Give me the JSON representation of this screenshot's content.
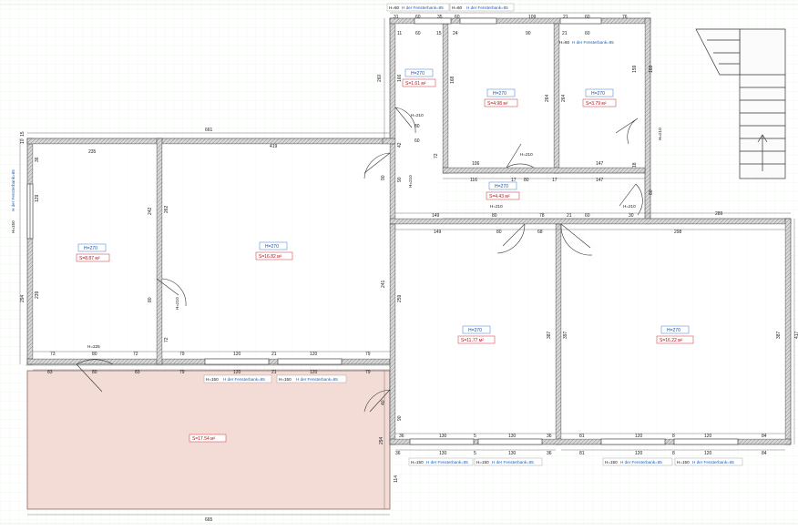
{
  "colors": {
    "grid": "#d7e8d7",
    "wall": "#555555",
    "terrace": "#f3dcd5",
    "room_s": "#b5121b",
    "blue_text": "#1a5fbf"
  },
  "rooms": [
    {
      "id": "r1",
      "h": "H=270",
      "s": "S=8.87 м²"
    },
    {
      "id": "r2",
      "h": "H=270",
      "s": "S=16.82 м²"
    },
    {
      "id": "r3",
      "h": "H=270",
      "s": "S=1.61 м²"
    },
    {
      "id": "r4",
      "h": "H=270",
      "s": "S=4.98 м²"
    },
    {
      "id": "r5",
      "h": "H=270",
      "s": "S=3.79 м²"
    },
    {
      "id": "r6",
      "h": "H=270",
      "s": "S=4.43 м²"
    },
    {
      "id": "r7",
      "h": "H=270",
      "s": "S=11.77 м²"
    },
    {
      "id": "r8",
      "h": "H=270",
      "s": "S=16.22 м²"
    }
  ],
  "terrace": {
    "s": "S=17.54 м²"
  },
  "windows": {
    "top_a": "H=60",
    "top_a_sill": "H der Fensterbank=85",
    "top_b": "H=60",
    "top_b_sill": "H der Fensterbank=85",
    "r5": "H=60",
    "r5_sill": "H der Fensterbank=85",
    "left": "H=150",
    "left_sill": "H der Fensterbank=65",
    "mid_a": "H=150",
    "mid_a_sill": "H der Fensterbank=65",
    "mid_b": "H=150",
    "mid_b_sill": "H der Fensterbank=65",
    "bot_a": "H=150",
    "bot_a_sill": "H der Fensterbank=65",
    "bot_b": "H=150",
    "bot_b_sill": "H der Fensterbank=65",
    "bot_c": "H=150",
    "bot_c_sill": "H der Fensterbank=65",
    "bot_d": "H=150",
    "bot_d_sill": "H der Fensterbank=65"
  },
  "doors": {
    "d1": "H=210",
    "d2": "H=210",
    "d3": "H=210",
    "d4": "H=210",
    "d5": "H=210",
    "d6": "H=210",
    "d7": "H=210",
    "d8": "H=225"
  },
  "dims": {
    "top1": "31",
    "top2": "60",
    "top3": "35",
    "top4": "60",
    "top5": "109",
    "top6": "21",
    "top7": "60",
    "top8": "76",
    "row2a": "11",
    "row2b": "60",
    "row2c": "15",
    "row2d": "24",
    "row2e": "90",
    "row2f": "21",
    "row2g": "60",
    "overall_top": "661",
    "r1_top": "235",
    "r2_top": "419",
    "c_80": "80",
    "c_60": "60",
    "c_106": "106",
    "c_116": "116",
    "c_147a": "147",
    "c_147b": "147",
    "c_80b": "80",
    "c_17a": "17",
    "c_17b": "17",
    "c_149": "149",
    "c_80c": "80",
    "c_78": "78",
    "c_21a": "21",
    "c_60b": "60",
    "c_30": "30",
    "c_289": "289",
    "c_149b": "149",
    "c_80d": "80",
    "c_68": "68",
    "c_298": "298",
    "b_73": "73",
    "b_80": "80",
    "b_72": "72",
    "b_79": "79",
    "b_120": "120",
    "b_21": "21",
    "b_120b": "120",
    "b_79b": "79",
    "o_83": "83",
    "o_80": "80",
    "o_83b": "83",
    "o_79": "79",
    "o_120": "120",
    "o_21": "21",
    "o_120b": "120",
    "o_79b": "79",
    "k_36": "36",
    "k_130": "130",
    "k_5": "5",
    "k_130b": "130",
    "k_36b": "36",
    "k_81": "81",
    "k_120": "120",
    "k_8": "8",
    "k_120b": "120",
    "k_84": "84",
    "m_36": "36",
    "m_130": "130",
    "m_5": "5",
    "m_130b": "130",
    "m_36b": "36",
    "m_81": "81",
    "m_120": "120",
    "m_8": "8",
    "m_120b": "120",
    "m_84": "84",
    "bottom": "665",
    "v_289": "289",
    "v_298": "298",
    "v_10": "10",
    "v_15": "15",
    "v_36": "36",
    "v_129": "129",
    "v_242": "242",
    "v_262": "262",
    "v_80": "80",
    "v_72": "72",
    "v_239": "239",
    "v_241": "241",
    "v_294": "294",
    "v_260": "260",
    "v_259": "259",
    "v_387": "387",
    "v_417": "417",
    "v_397": "397",
    "v_114": "114",
    "v_166": "166",
    "v_168": "168",
    "v_264": "264",
    "v_159": "159",
    "v_42": "42",
    "v_92": "92",
    "v_90": "90",
    "v_18": "18",
    "v_15b": "15",
    "v_60": "60",
    "v_40": "40"
  }
}
